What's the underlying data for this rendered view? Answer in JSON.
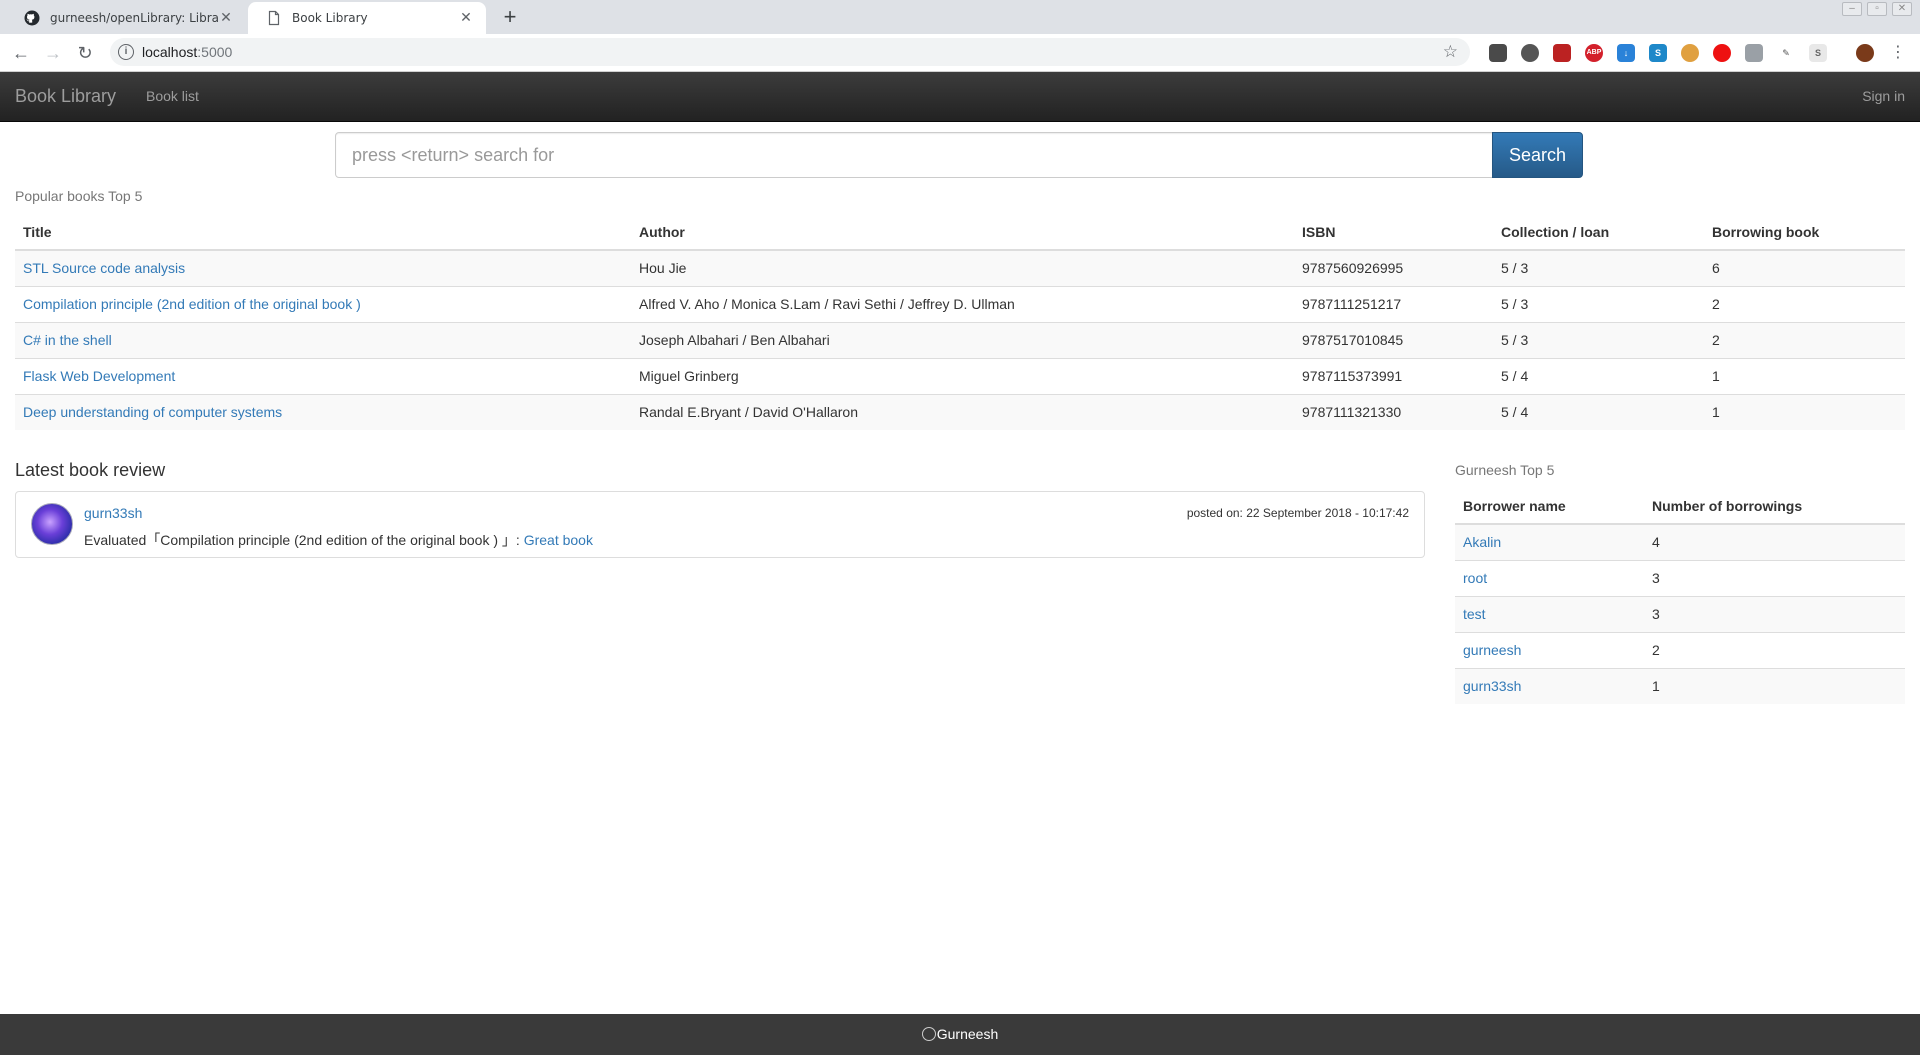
{
  "browser": {
    "tabs": [
      {
        "title": "gurneesh/openLibrary: Library m",
        "active": false,
        "icon": "github-icon"
      },
      {
        "title": "Book Library",
        "active": true,
        "icon": "page-icon"
      }
    ],
    "new_tab": "+",
    "url_host": "localhost",
    "url_port": ":5000",
    "extension_labels": {
      "abp": "ABP",
      "s": "S"
    }
  },
  "navbar": {
    "brand": "Book Library",
    "book_list": "Book list",
    "sign_in": "Sign in"
  },
  "search": {
    "placeholder": "press <return> search for",
    "button": "Search"
  },
  "popular": {
    "caption": "Popular books Top 5",
    "headers": [
      "Title",
      "Author",
      "ISBN",
      "Collection / loan",
      "Borrowing book"
    ],
    "rows": [
      {
        "title": "STL Source code analysis",
        "author": "Hou Jie",
        "isbn": "9787560926995",
        "collection_loan": "5 / 3",
        "borrowing": "6"
      },
      {
        "title": "Compilation principle (2nd edition of the original book )",
        "author": "Alfred V. Aho / Monica S.Lam / Ravi Sethi / Jeffrey D. Ullman",
        "isbn": "9787111251217",
        "collection_loan": "5 / 3",
        "borrowing": "2"
      },
      {
        "title": "C# in the shell",
        "author": "Joseph Albahari / Ben Albahari",
        "isbn": "9787517010845",
        "collection_loan": "5 / 3",
        "borrowing": "2"
      },
      {
        "title": "Flask Web Development",
        "author": "Miguel Grinberg",
        "isbn": "9787115373991",
        "collection_loan": "5 / 4",
        "borrowing": "1"
      },
      {
        "title": "Deep understanding of computer systems",
        "author": "Randal E.Bryant / David O'Hallaron",
        "isbn": "9787111321330",
        "collection_loan": "5 / 4",
        "borrowing": "1"
      }
    ]
  },
  "review": {
    "heading": "Latest book review",
    "user": "gurn33sh",
    "posted": "posted on: 22 September 2018 - 10:17:42",
    "text_prefix": "Evaluated「Compilation principle (2nd edition of the original book ) 」:",
    "link_text": "Great book"
  },
  "borrowers": {
    "caption": "Gurneesh Top 5",
    "headers": [
      "Borrower name",
      "Number of borrowings"
    ],
    "rows": [
      {
        "name": "Akalin",
        "count": "4"
      },
      {
        "name": "root",
        "count": "3"
      },
      {
        "name": "test",
        "count": "3"
      },
      {
        "name": "gurneesh",
        "count": "2"
      },
      {
        "name": "gurn33sh",
        "count": "1"
      }
    ]
  },
  "footer": {
    "text": "Gurneesh"
  }
}
